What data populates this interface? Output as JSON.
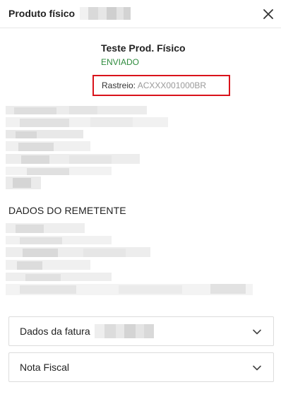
{
  "header": {
    "title": "Produto físico",
    "close_icon": "close-icon"
  },
  "product": {
    "name": "Teste Prod. Físico",
    "status": "ENVIADO",
    "status_color": "#2e8b3d"
  },
  "tracking": {
    "label": "Rastreio:",
    "code": "ACXXX001000BR",
    "highlight_color": "#d9131b"
  },
  "sender_section": {
    "title": "DADOS DO REMETENTE"
  },
  "accordions": [
    {
      "label": "Dados da fatura",
      "icon": "chevron-down-icon"
    },
    {
      "label": "Nota Fiscal",
      "icon": "chevron-down-icon"
    }
  ]
}
